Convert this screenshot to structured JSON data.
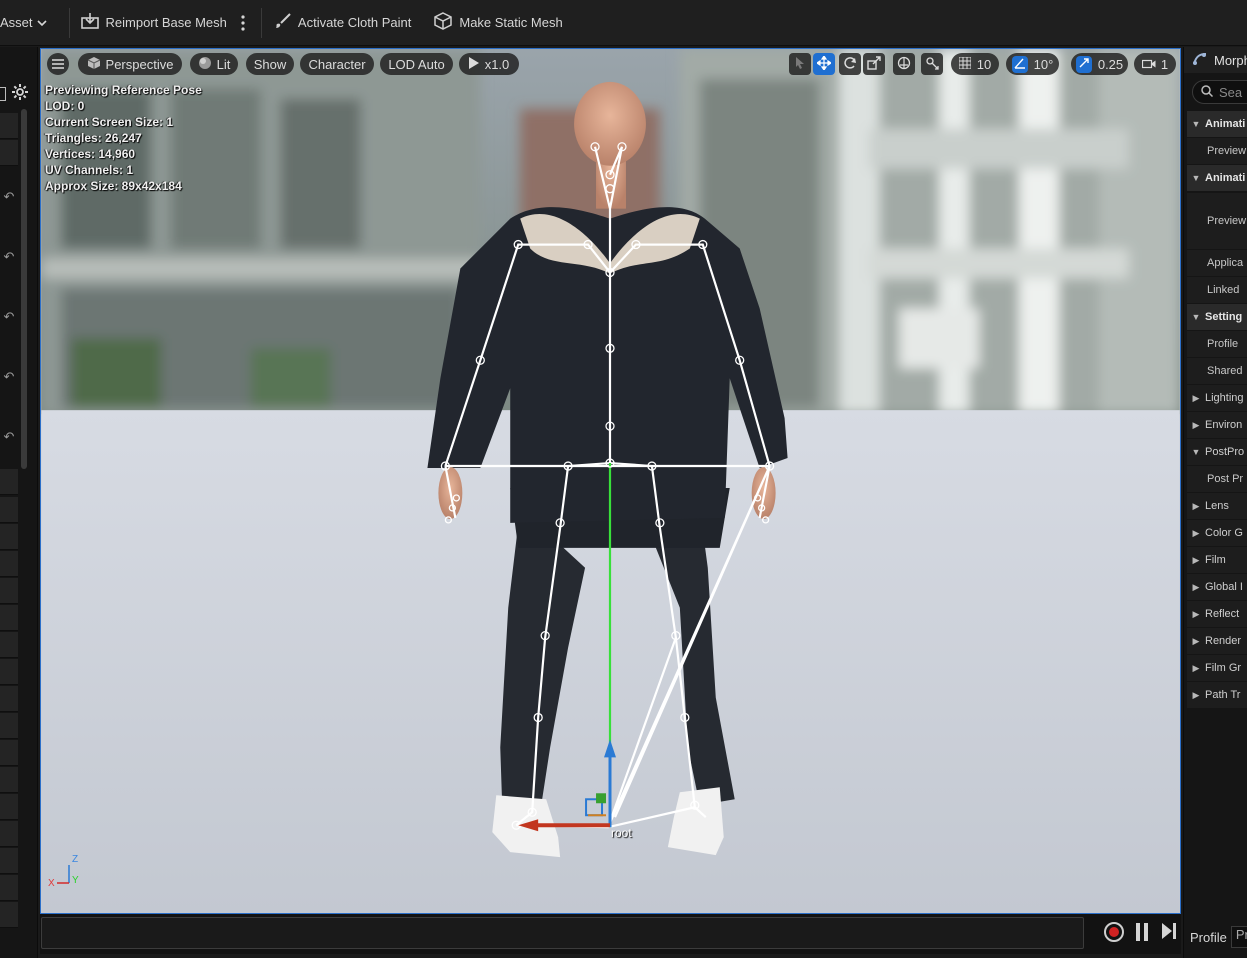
{
  "toolbar": {
    "asset_label": "Asset",
    "reimport_label": "Reimport Base Mesh",
    "cloth_paint_label": "Activate Cloth Paint",
    "static_mesh_label": "Make Static Mesh"
  },
  "viewport": {
    "perspective_label": "Perspective",
    "lit_label": "Lit",
    "show_label": "Show",
    "character_label": "Character",
    "lod_label": "LOD Auto",
    "speed_label": "x1.0",
    "grid_snap_value": "10",
    "rotation_snap_value": "10°",
    "scale_snap_value": "0.25",
    "camera_speed_value": "1",
    "stats": {
      "line1": "Previewing Reference Pose",
      "line2": "LOD: 0",
      "line3": "Current Screen Size: 1",
      "line4": "Triangles: 26,247",
      "line5": "Vertices: 14,960",
      "line6": "UV Channels: 1",
      "line7": "Approx Size: 89x42x184"
    },
    "root_bone_label": "root",
    "axis_labels": {
      "z": "Z",
      "y": "Y",
      "x": "X"
    },
    "colors": {
      "accent": "#1f6fd1",
      "x_axis": "#d42a2a",
      "y_axis": "#2ad12a",
      "z_axis": "#2a7ad4"
    }
  },
  "right_panel": {
    "tab_label": "Morph",
    "search_placeholder": "Sea",
    "rows": [
      {
        "kind": "header",
        "label": "Animati"
      },
      {
        "kind": "prop",
        "label": "Preview"
      },
      {
        "kind": "header",
        "label": "Animati"
      },
      {
        "kind": "prop",
        "label": "Preview"
      },
      {
        "kind": "prop",
        "label": "Applica"
      },
      {
        "kind": "prop",
        "label": "Linked"
      },
      {
        "kind": "header",
        "label": "Setting"
      },
      {
        "kind": "prop",
        "label": "Profile"
      },
      {
        "kind": "prop",
        "label": "Shared"
      },
      {
        "kind": "cat",
        "label": "Lighting"
      },
      {
        "kind": "cat",
        "label": "Environ"
      },
      {
        "kind": "header-open",
        "label": "PostPro"
      },
      {
        "kind": "prop",
        "label": "Post Pr"
      },
      {
        "kind": "cat",
        "label": "Lens"
      },
      {
        "kind": "cat",
        "label": "Color G"
      },
      {
        "kind": "cat",
        "label": "Film"
      },
      {
        "kind": "cat",
        "label": "Global I"
      },
      {
        "kind": "cat",
        "label": "Reflect"
      },
      {
        "kind": "cat",
        "label": "Render"
      },
      {
        "kind": "cat",
        "label": "Film Gr"
      },
      {
        "kind": "cat",
        "label": "Path Tr"
      }
    ],
    "profile_label": "Profile",
    "profile_value": "Pr"
  }
}
